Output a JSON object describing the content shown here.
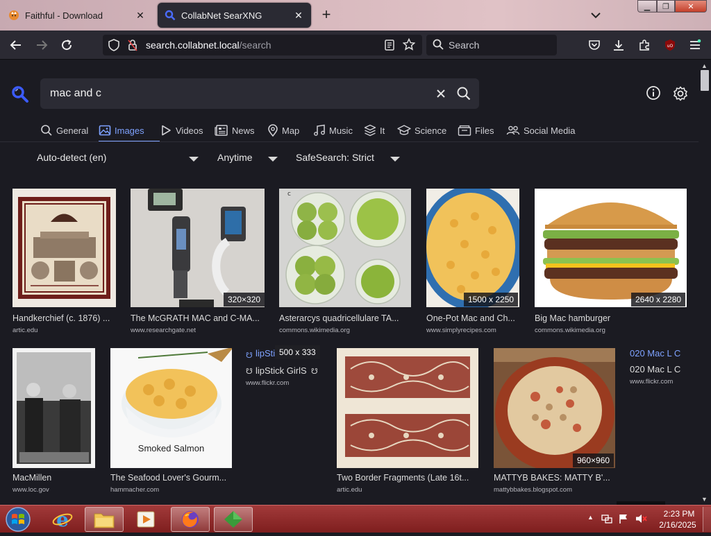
{
  "browser": {
    "tabs": [
      {
        "title": "Faithful - Download"
      },
      {
        "title": "CollabNet SearXNG"
      }
    ],
    "url_host": "search.collabnet.local",
    "url_path": "/search",
    "search_placeholder": "Search"
  },
  "page": {
    "query": "mac and c",
    "categories": [
      {
        "label": "General",
        "icon": "search-icon"
      },
      {
        "label": "Images",
        "icon": "image-icon",
        "active": true
      },
      {
        "label": "Videos",
        "icon": "play-icon"
      },
      {
        "label": "News",
        "icon": "newspaper-icon"
      },
      {
        "label": "Map",
        "icon": "map-pin-icon"
      },
      {
        "label": "Music",
        "icon": "music-icon"
      },
      {
        "label": "It",
        "icon": "layers-icon"
      },
      {
        "label": "Science",
        "icon": "graduation-cap-icon"
      },
      {
        "label": "Files",
        "icon": "files-icon"
      },
      {
        "label": "Social Media",
        "icon": "people-icon"
      }
    ],
    "filters": {
      "language": "Auto-detect (en)",
      "time": "Anytime",
      "safesearch": "SafeSearch: Strict"
    },
    "results": [
      {
        "title": "Handkerchief (c. 1876) ...",
        "domain": "artic.edu",
        "dims": ""
      },
      {
        "title": "The McGRATH MAC and C-MA...",
        "domain": "www.researchgate.net",
        "dims": "320×320"
      },
      {
        "title": "Asterarcys quadricellulare TA...",
        "domain": "commons.wikimedia.org",
        "dims": ""
      },
      {
        "title": "One-Pot Mac and Ch...",
        "domain": "www.simplyrecipes.com",
        "dims": "1500 x 2250"
      },
      {
        "title": "Big Mac hamburger",
        "domain": "commons.wikimedia.org",
        "dims": "2640 x 2280"
      },
      {
        "title": "MacMillen",
        "domain": "www.loc.gov",
        "dims": ""
      },
      {
        "title": "The Seafood Lover's Gourm...",
        "domain": "hammacher.com",
        "dims": "",
        "caption": "Smoked Salmon"
      },
      {
        "title": "lipStick GirlS",
        "alt": "lipStick GirlS",
        "domain": "www.flickr.com",
        "dims": "500 x 333"
      },
      {
        "title": "Two Border Fragments (Late 16t...",
        "domain": "artic.edu",
        "dims": ""
      },
      {
        "title": "MATTYB BAKES: MATTY B'...",
        "domain": "mattybbakes.blogspot.com",
        "dims": "960×960"
      },
      {
        "title": "020 Mac L C",
        "alt": "020 Mac L C",
        "domain": "www.flickr.com",
        "dims": ""
      }
    ]
  },
  "taskbar": {
    "time": "2:23 PM",
    "date": "2/16/2025"
  },
  "colors": {
    "accent": "#7ea2ff",
    "page_bg": "#1b1b22",
    "taskbar": "#8e2a2a"
  }
}
